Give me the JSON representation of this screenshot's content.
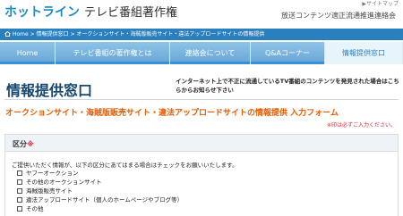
{
  "header": {
    "brand_main": "ホットライン",
    "brand_sub": "テレビ番組著作権",
    "top_mini": "▶サイトマップ",
    "org": "放送コンテンツ適正流通推進連絡会"
  },
  "breadcrumb": {
    "text": "Home > 情報提供窓口 > オークションサイト・海賊版販売サイト・違法アップロードサイトの情報提供"
  },
  "nav": {
    "tabs": [
      {
        "label": "Home"
      },
      {
        "label": "テレビ番組の著作権とは"
      },
      {
        "label": "連絡会について"
      },
      {
        "label": "Q&Aコーナー"
      },
      {
        "label": "情報提供窓口"
      }
    ]
  },
  "page": {
    "title": "情報提供窓口",
    "note": "インターネット上で不正に流通しているTV番組のコンテンツを発見された場合はこちらからお知らせ下さい",
    "form_heading": "オークションサイト・海賊版販売サイト・違法アップロードサイトの情報提供 入力フォーム",
    "required_note": "※印は必ずご入力ください。"
  },
  "section": {
    "label": "区分",
    "req_mark": "※",
    "instruction": "ご提供いただく情報が、以下の区分にあてはまる場合はチェックをお願いいたします。",
    "options": [
      "ヤフーオークション",
      "その他のオークションサイト",
      "海賊版販売サイト",
      "違法アップロードサイト（個人のホームページやブログ等）",
      "その他"
    ]
  },
  "colors": {
    "brand_blue": "#1f8bc4",
    "nav_blue": "#6aa9d8",
    "title_navy": "#16466e",
    "heading_orange": "#e55b00"
  }
}
